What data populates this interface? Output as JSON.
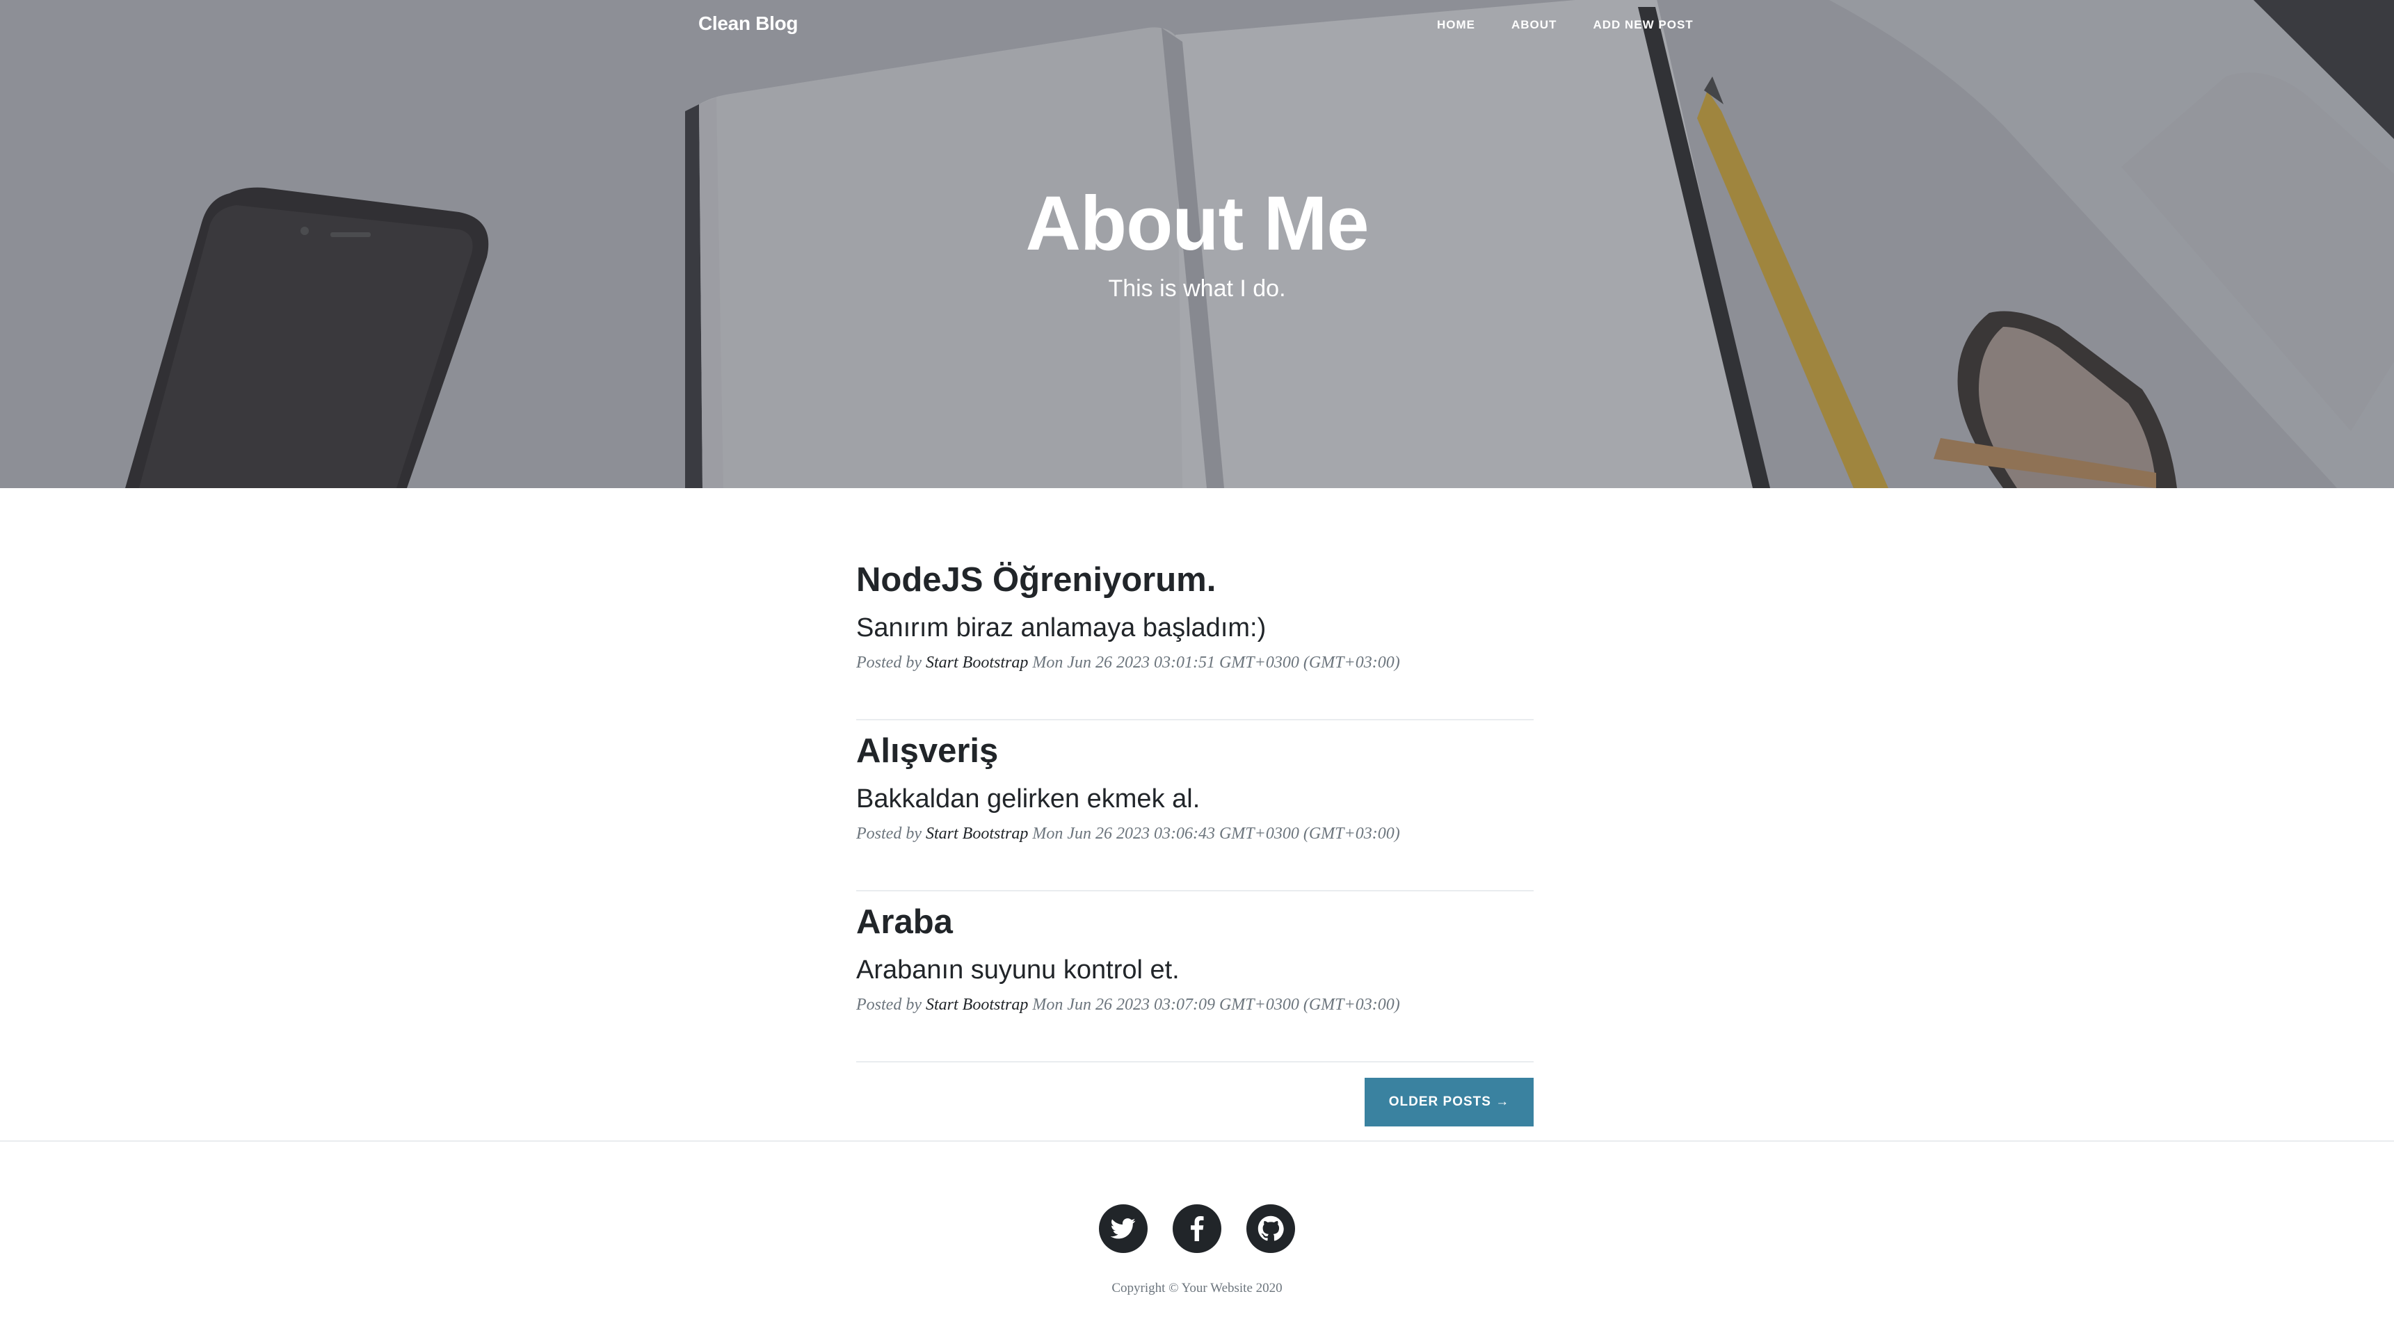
{
  "nav": {
    "brand": "Clean Blog",
    "links": [
      {
        "label": "Home"
      },
      {
        "label": "About"
      },
      {
        "label": "Add New Post"
      }
    ]
  },
  "hero": {
    "title": "About Me",
    "subtitle": "This is what I do."
  },
  "posts": [
    {
      "title": "NodeJS Öğreniyorum.",
      "subtitle": "Sanırım biraz anlamaya başladım:)",
      "meta_prefix": "Posted by",
      "author": "Start Bootstrap",
      "date": "Mon Jun 26 2023 03:01:51 GMT+0300 (GMT+03:00)"
    },
    {
      "title": "Alışveriş",
      "subtitle": "Bakkaldan gelirken ekmek al.",
      "meta_prefix": "Posted by",
      "author": "Start Bootstrap",
      "date": "Mon Jun 26 2023 03:06:43 GMT+0300 (GMT+03:00)"
    },
    {
      "title": "Araba",
      "subtitle": "Arabanın suyunu kontrol et.",
      "meta_prefix": "Posted by",
      "author": "Start Bootstrap",
      "date": "Mon Jun 26 2023 03:07:09 GMT+0300 (GMT+03:00)"
    }
  ],
  "pager": {
    "older_label": "Older Posts →"
  },
  "footer": {
    "social": [
      {
        "icon": "twitter-icon"
      },
      {
        "icon": "facebook-icon"
      },
      {
        "icon": "github-icon"
      }
    ],
    "copyright": "Copyright © Your Website 2020"
  },
  "colors": {
    "accent": "#3a82a0",
    "text": "#212529",
    "muted": "#6c757d"
  }
}
